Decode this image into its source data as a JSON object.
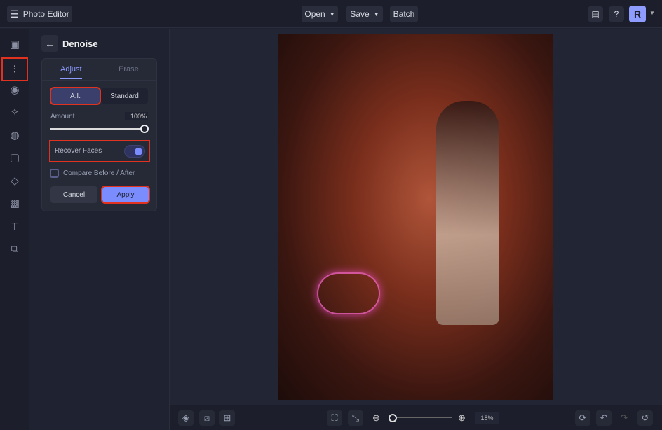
{
  "app": {
    "title": "Photo Editor",
    "menu": [
      "Open",
      "Save",
      "Batch"
    ],
    "avatar": "R"
  },
  "panel": {
    "title": "Denoise",
    "tabs": [
      "Adjust",
      "Erase"
    ],
    "modes": [
      "A.I.",
      "Standard"
    ],
    "amount_label": "Amount",
    "amount_value": "100%",
    "amount": 100,
    "recover_faces": "Recover Faces",
    "recover_on": true,
    "compare": "Compare Before / After",
    "cancel": "Cancel",
    "apply": "Apply"
  },
  "zoom": {
    "value": "18%",
    "level": 18
  },
  "colors": {
    "accent": "#7b8cff",
    "highlight": "#e0321f"
  }
}
